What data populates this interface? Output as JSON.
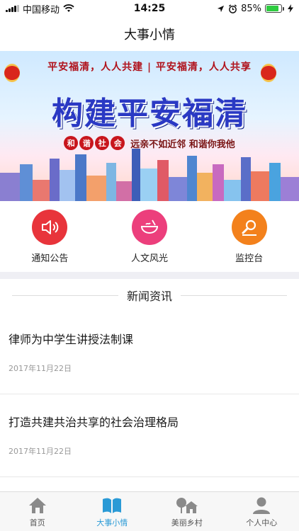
{
  "status_bar": {
    "carrier": "中国移动",
    "time": "14:25",
    "battery_percent": "85%",
    "battery_level": 0.85
  },
  "nav": {
    "title": "大事小情"
  },
  "banner": {
    "slogan": "平安福清，人人共建 | 平安福清，人人共享",
    "title": "构建平安福清",
    "badge": [
      "和",
      "谐",
      "社",
      "会"
    ],
    "subtitle": "远亲不如近邻 和谐你我他"
  },
  "quick_links": [
    {
      "label": "通知公告",
      "icon": "speaker-icon",
      "color": "#e8343b"
    },
    {
      "label": "人文风光",
      "icon": "bowl-icon",
      "color": "#ec3f7c"
    },
    {
      "label": "监控台",
      "icon": "monitor-search-icon",
      "color": "#f3811c"
    }
  ],
  "news": {
    "header": "新闻资讯",
    "items": [
      {
        "title": "律师为中学生讲授法制课",
        "date": "2017年11月22日"
      },
      {
        "title": "打造共建共治共享的社会治理格局",
        "date": "2017年11月22日"
      }
    ]
  },
  "tabs": [
    {
      "label": "首页",
      "icon": "home-icon",
      "active": false
    },
    {
      "label": "大事小情",
      "icon": "book-icon",
      "active": true
    },
    {
      "label": "美丽乡村",
      "icon": "village-icon",
      "active": false
    },
    {
      "label": "个人中心",
      "icon": "user-icon",
      "active": false
    }
  ],
  "colors": {
    "accent": "#2a9ad6",
    "inactive": "#8a8a8a"
  }
}
